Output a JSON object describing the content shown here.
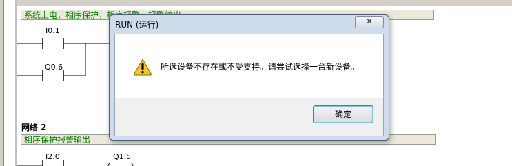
{
  "editor": {
    "network1_comment": "系统上电，相序保护，相序报警，报警输出",
    "network1_contacts": [
      "I0.1",
      "Q0.6"
    ],
    "network2_title": "网络 2",
    "network2_comment": "相序保护报警输出",
    "network2_contact": "I2.0",
    "network2_coil": "Q1.5"
  },
  "dialog": {
    "title": "RUN (运行)",
    "close_symbol": "✕",
    "icon": "warning-icon",
    "message": "所选设备不存在或不受支持。请尝试选择一台新设备。",
    "ok_label": "确定"
  },
  "colors": {
    "comment_text": "#008000",
    "comment_bg": "#ece9d8",
    "dialog_frame": "#cfdcec",
    "warning_yellow": "#f3c623"
  }
}
